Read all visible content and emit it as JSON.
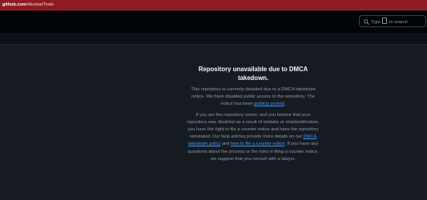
{
  "browser": {
    "url_host": "github.com",
    "url_path": "/Akurias/Tools"
  },
  "header": {
    "search": {
      "prefix": "Type",
      "suffix": "to search"
    }
  },
  "notice": {
    "title": "Repository unavailable due to DMCA takedown.",
    "paragraph1": {
      "text": "This repository is currently disabled due to a DMCA takedown notice. We have disabled public access to the repository. The notice has been ",
      "link": "publicly posted",
      "end": "."
    },
    "paragraph2": {
      "text1": "If you are the repository owner, and you believe that your repository was disabled as a result of mistake or misidentification, you have the right to file a counter notice and have the repository reinstated. Our help articles provide more details on our ",
      "link1": "DMCA takedown policy",
      "text2": " and ",
      "link2": "how to file a counter notice",
      "text3": ". If you have any questions about the process or the risks in filing a counter notice, we suggest that you consult with a lawyer."
    }
  },
  "colors": {
    "address_bar": "#8e1b22",
    "page_bg": "#161b22",
    "header_bg": "#010409",
    "link": "#4493f8"
  }
}
